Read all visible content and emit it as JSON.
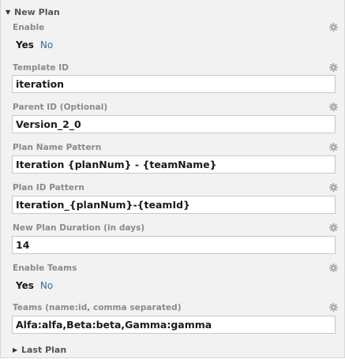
{
  "new_plan": {
    "header": "New Plan",
    "enable": {
      "label": "Enable",
      "yes": "Yes",
      "no": "No"
    },
    "template_id": {
      "label": "Template ID",
      "value": "iteration"
    },
    "parent_id": {
      "label": "Parent ID (Optional)",
      "value": "Version_2_0"
    },
    "plan_name_pattern": {
      "label": "Plan Name Pattern",
      "value": "Iteration {planNum} - {teamName}"
    },
    "plan_id_pattern": {
      "label": "Plan ID Pattern",
      "value": "Iteration_{planNum}-{teamId}"
    },
    "duration": {
      "label": "New Plan Duration (in days)",
      "value": "14"
    },
    "enable_teams": {
      "label": "Enable Teams",
      "yes": "Yes",
      "no": "No"
    },
    "teams": {
      "label": "Teams (name:id, comma separated)",
      "value": "Alfa:alfa,Beta:beta,Gamma:gamma"
    }
  },
  "last_plan": {
    "header": "Last Plan"
  },
  "icons": {
    "expanded": "triangle-down",
    "collapsed": "triangle-right",
    "settings": "gear-icon"
  },
  "colors": {
    "panel_bg": "#f2f2f2",
    "label": "#8a8a8a",
    "link": "#2f6fa7",
    "gear": "#a8a8a8"
  }
}
